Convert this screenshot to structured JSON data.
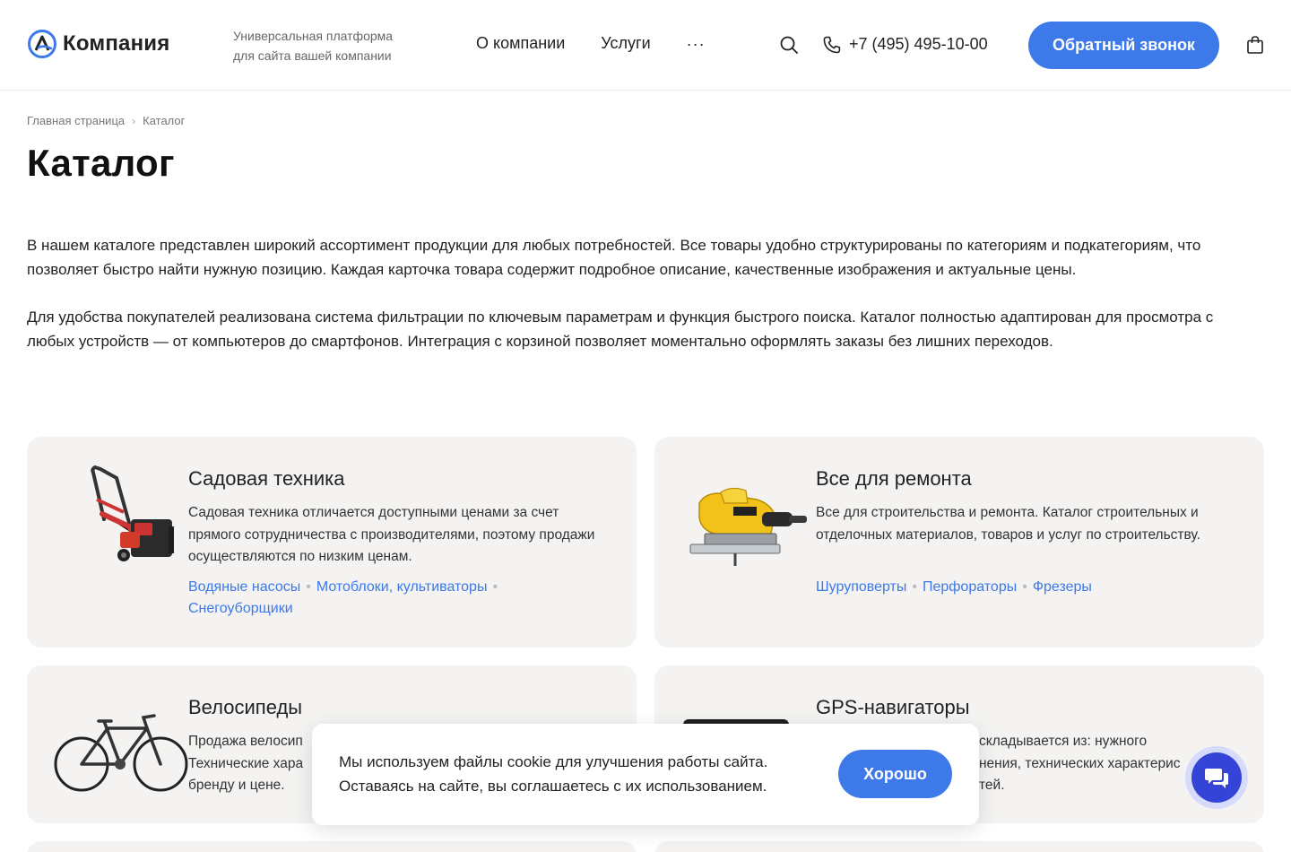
{
  "header": {
    "logo_text": "Компания",
    "tagline_line1": "Универсальная платформа",
    "tagline_line2": "для сайта вашей компании",
    "nav": [
      {
        "label": "О компании"
      },
      {
        "label": "Услуги"
      },
      {
        "label": "···"
      }
    ],
    "phone": "+7 (495) 495-10-00",
    "callback_label": "Обратный звонок",
    "accent_color": "#3d79e8"
  },
  "breadcrumb": {
    "home": "Главная страница",
    "separator": "›",
    "current": "Каталог"
  },
  "page_title": "Каталог",
  "intro": {
    "p1": "В нашем каталоге представлен широкий ассортимент продукции для любых потребностей. Все товары удобно структурированы по категориям и подкатегориям, что позволяет быстро найти нужную позицию. Каждая карточка товара содержит подробное описание, качественные изображения и актуальные цены.",
    "p2": "Для удобства покупателей реализована система фильтрации по ключевым параметрам и функция быстрого поиска. Каталог полностью адаптирован для просмотра с любых устройств — от компьютеров до смартфонов. Интеграция с корзиной позволяет моментально оформлять заказы без лишних переходов."
  },
  "categories": [
    {
      "title": "Садовая техника",
      "image_icon": "snow-blower-image",
      "desc": "Садовая техника отличается доступными ценами за счет прямого сотрудничества с производителями, поэтому продажи осуществляются по низким ценам.",
      "links": [
        "Водяные насосы",
        "Мотоблоки, культиваторы",
        "Снегоуборщики"
      ]
    },
    {
      "title": "Все для ремонта",
      "image_icon": "jigsaw-image",
      "desc": "Все для строительства и ремонта. Каталог строительных и отделочных материалов, товаров и услуг по строительству.",
      "links": [
        "Шуруповерты",
        "Перфораторы",
        "Фрезеры"
      ]
    },
    {
      "title": "Велосипеды",
      "image_icon": "bicycle-image",
      "desc_visible_line1": "Продажа велосип",
      "desc_visible_line2": "Технические хара",
      "desc_visible_line3": "бренду и цене."
    },
    {
      "title": "GPS-навигаторы",
      "image_icon": "gps-navigator-image",
      "desc_visible_line1": "складывается из: нужного",
      "desc_visible_line2": "нения, технических характерис",
      "desc_visible_line3": "тей."
    }
  ],
  "cookie": {
    "line1": "Мы используем файлы cookie для улучшения работы сайта.",
    "line2": "Оставаясь на сайте, вы соглашаетесь с их использованием.",
    "button": "Хорошо"
  }
}
